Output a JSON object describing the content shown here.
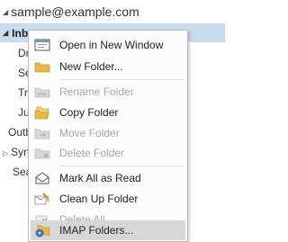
{
  "account": {
    "email": "sample@example.com"
  },
  "inbox": {
    "label": "Inbox"
  },
  "folders": {
    "drafts": "Dra",
    "sent": "Sen",
    "trash": "Tra",
    "junk": "Jun",
    "outbox": "Outb",
    "sync": "Sync",
    "search": "Sear"
  },
  "menu": {
    "items": [
      {
        "label": "Open in New Window",
        "icon": "new-window-icon"
      },
      {
        "label": "New Folder...",
        "icon": "new-folder-icon"
      },
      {
        "label": "Rename Folder",
        "icon": "rename-folder-icon"
      },
      {
        "label": "Copy Folder",
        "icon": "copy-folder-icon"
      },
      {
        "label": "Move Folder",
        "icon": "move-folder-icon"
      },
      {
        "label": "Delete Folder",
        "icon": "delete-folder-icon"
      },
      {
        "label": "Mark All as Read",
        "icon": "envelope-open-icon"
      },
      {
        "label": "Clean Up Folder",
        "icon": "clean-up-icon"
      },
      {
        "label": "Delete All",
        "icon": "delete-all-icon"
      },
      {
        "label": "IMAP Folders...",
        "icon": "imap-folders-icon"
      }
    ]
  },
  "colors": {
    "accent": "#c9dcef",
    "highlight": "#d7d7d7",
    "folder": "#e8b84a",
    "disabled": "#a8a8a8"
  }
}
